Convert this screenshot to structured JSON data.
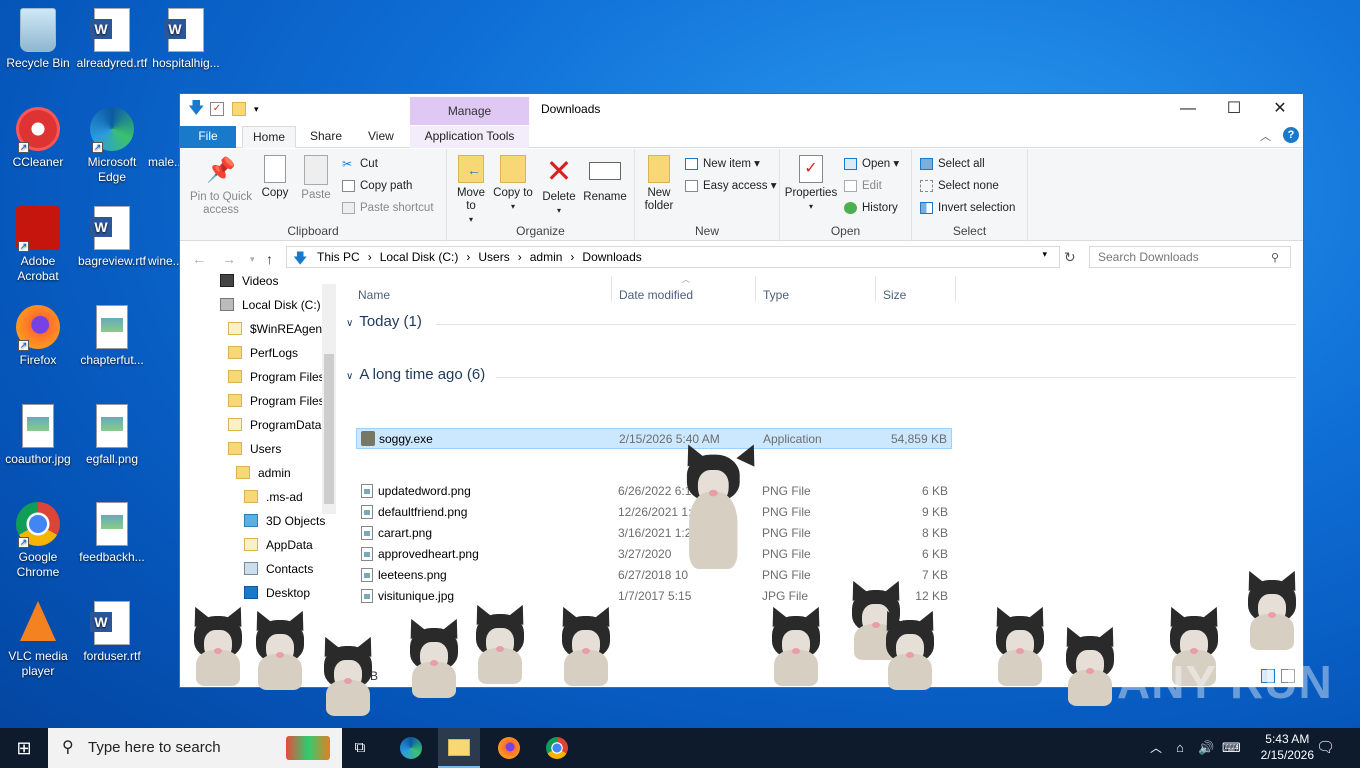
{
  "desktop": {
    "icons": [
      {
        "label": "Recycle Bin",
        "icon": "recycle-bin-icon"
      },
      {
        "label": "alreadyred.rtf",
        "icon": "word-doc-icon"
      },
      {
        "label": "hospitalhig...",
        "icon": "word-doc-icon"
      },
      {
        "label": "CCleaner",
        "icon": "ccleaner-icon"
      },
      {
        "label": "Microsoft Edge",
        "icon": "edge-icon"
      },
      {
        "label": "male...",
        "icon": "word-doc-icon"
      },
      {
        "label": "Adobe Acrobat",
        "icon": "acrobat-icon"
      },
      {
        "label": "bagreview.rtf",
        "icon": "word-doc-icon"
      },
      {
        "label": "wine...",
        "icon": "word-doc-icon"
      },
      {
        "label": "Firefox",
        "icon": "firefox-icon"
      },
      {
        "label": "chapterfut...",
        "icon": "image-file-icon"
      },
      {
        "label": "coauthor.jpg",
        "icon": "image-file-icon"
      },
      {
        "label": "egfall.png",
        "icon": "image-file-icon"
      },
      {
        "label": "Google Chrome",
        "icon": "chrome-icon"
      },
      {
        "label": "feedbackh...",
        "icon": "image-file-icon"
      },
      {
        "label": "VLC media player",
        "icon": "vlc-icon"
      },
      {
        "label": "forduser.rtf",
        "icon": "word-doc-icon"
      }
    ]
  },
  "explorer": {
    "title": "Downloads",
    "contextual_tab": "Manage",
    "tabs": {
      "file": "File",
      "home": "Home",
      "share": "Share",
      "view": "View",
      "app_tools": "Application Tools"
    },
    "ribbon": {
      "clipboard": {
        "label": "Clipboard",
        "pin": "Pin to Quick access",
        "copy": "Copy",
        "paste": "Paste",
        "cut": "Cut",
        "copy_path": "Copy path",
        "paste_shortcut": "Paste shortcut"
      },
      "organize": {
        "label": "Organize",
        "move_to": "Move to",
        "copy_to": "Copy to",
        "delete": "Delete",
        "rename": "Rename"
      },
      "new": {
        "label": "New",
        "new_folder": "New folder",
        "new_item": "New item",
        "easy_access": "Easy access"
      },
      "open": {
        "label": "Open",
        "properties": "Properties",
        "open": "Open",
        "edit": "Edit",
        "history": "History"
      },
      "select": {
        "label": "Select",
        "select_all": "Select all",
        "select_none": "Select none",
        "invert": "Invert selection"
      }
    },
    "address": {
      "crumbs": [
        "This PC",
        "Local Disk (C:)",
        "Users",
        "admin",
        "Downloads"
      ],
      "search_placeholder": "Search Downloads"
    },
    "nav": [
      "Videos",
      "Local Disk (C:)",
      "$WinREAgent",
      "PerfLogs",
      "Program Files",
      "Program Files",
      "ProgramData",
      "Users",
      "admin",
      ".ms-ad",
      "3D Objects",
      "AppData",
      "Contacts",
      "Desktop"
    ],
    "columns": {
      "name": "Name",
      "date": "Date modified",
      "type": "Type",
      "size": "Size"
    },
    "groups": [
      {
        "title": "Today (1)",
        "files": [
          {
            "name": "soggy.exe",
            "date": "2/15/2026 5:40 AM",
            "type": "Application",
            "size": "54,859 KB"
          }
        ]
      },
      {
        "title": "A long time ago (6)",
        "files": [
          {
            "name": "updatedword.png",
            "date": "6/26/2022 6:14 PM",
            "type": "PNG File",
            "size": "6 KB"
          },
          {
            "name": "defaultfriend.png",
            "date": "12/26/2021 1:58 PM",
            "type": "PNG File",
            "size": "9 KB"
          },
          {
            "name": "carart.png",
            "date": "3/16/2021 1:21 AM",
            "type": "PNG File",
            "size": "8 KB"
          },
          {
            "name": "approvedheart.png",
            "date": "3/27/2020",
            "type": "PNG File",
            "size": "6 KB"
          },
          {
            "name": "leeteens.png",
            "date": "6/27/2018 10",
            "type": "PNG File",
            "size": "7 KB"
          },
          {
            "name": "visitunique.jpg",
            "date": "1/7/2017 5:15",
            "type": "JPG File",
            "size": "12 KB"
          }
        ]
      }
    ],
    "status": "MB"
  },
  "taskbar": {
    "search_placeholder": "Type here to search",
    "time": "5:43 AM",
    "date": "2/15/2026"
  },
  "watermark": "ANY RUN"
}
